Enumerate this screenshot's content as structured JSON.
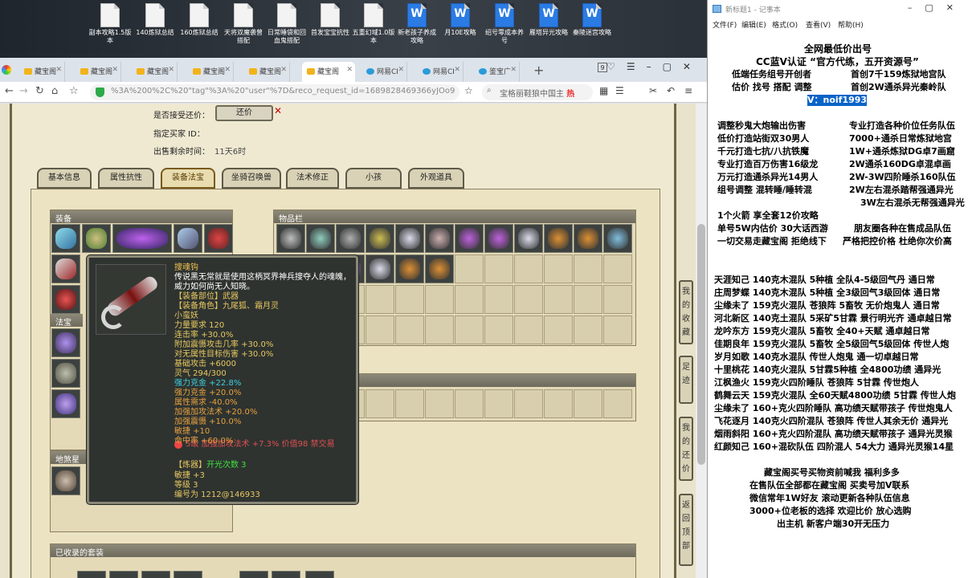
{
  "desktop_icons": [
    {
      "label": "副本攻略1.5版本",
      "type": "doc"
    },
    {
      "label": "140炼狱总结",
      "type": "doc"
    },
    {
      "label": "160炼狱总结",
      "type": "doc"
    },
    {
      "label": "天将双魔袭曾搭配",
      "type": "doc"
    },
    {
      "label": "日常睡袋和回血鬼搭配",
      "type": "doc"
    },
    {
      "label": "首发宝宝抗性",
      "type": "doc"
    },
    {
      "label": "五重幻域1.0版本",
      "type": "doc"
    },
    {
      "label": "新老孩子养成攻略",
      "type": "word"
    },
    {
      "label": "月10E攻略",
      "type": "word"
    },
    {
      "label": "绍号零成本养号",
      "type": "word"
    },
    {
      "label": "雁塔异光攻略",
      "type": "word"
    },
    {
      "label": "秦陵迷宫攻略",
      "type": "word"
    }
  ],
  "browser": {
    "tabs": [
      {
        "label": "藏宝阁",
        "icon": "treasure"
      },
      {
        "label": "藏宝阁",
        "icon": "treasure"
      },
      {
        "label": "藏宝阁",
        "icon": "treasure"
      },
      {
        "label": "藏宝阁",
        "icon": "treasure"
      },
      {
        "label": "藏宝阁",
        "icon": "treasure"
      },
      {
        "label": "藏宝阁",
        "icon": "treasure",
        "active": true
      },
      {
        "label": "网易CI",
        "icon": "globe"
      },
      {
        "label": "网易CI",
        "icon": "globe"
      },
      {
        "label": "鉴宝广",
        "icon": "globe"
      }
    ],
    "tab_count": "9",
    "url": "%3A%200%2C%20\"tag\"%3A%20\"user\"%7D&reco_request_id=1689828469366yJOo9",
    "search_text": "宝格丽鞋狼中国主",
    "search_hot": "热"
  },
  "listing": {
    "accept_offer_label": "是否接受还价：",
    "offer_button": "还价",
    "seller_id_label": "指定买家 ID：",
    "time_label": "出售剩余时间：",
    "time_value": "11天6时"
  },
  "game_tabs": [
    "基本信息",
    "属性抗性",
    "装备法宝",
    "坐骑召唤兽",
    "法术修正",
    "小孩",
    "外观道具"
  ],
  "active_tab": "装备法宝",
  "sections": {
    "equipment": "装备",
    "inventory": "物品栏",
    "fabao": "法宝",
    "fabao2": "地煞星",
    "suits": "已收录的套装"
  },
  "side_buttons": [
    "我的收藏",
    "足迹",
    "我的还价",
    "返回顶部"
  ],
  "tooltip": {
    "name": "搜魂钩",
    "desc1": "传说黑无常就是使用这柄冥界神兵搜夺人的魂魄，",
    "desc2": "威力如何尚无人知晓。",
    "slot": "【装备部位】武器",
    "role": "【装备角色】九尾狐、霜月灵",
    "role2": "小蛮妖",
    "lines": [
      {
        "t": "力量要求 120",
        "c": "#e8c860"
      },
      {
        "t": "连击率 +30.0%",
        "c": "#e8c860"
      },
      {
        "t": "附加震慑攻击几率 +30.0%",
        "c": "#e8c860"
      },
      {
        "t": "对无属性目标伤害 +30.0%",
        "c": "#e8c860"
      },
      {
        "t": "基础攻击 +6000",
        "c": "#e8c860"
      },
      {
        "t": "灵气 294/300",
        "c": "#e8c860"
      },
      {
        "t": "强力克金 +22.8%",
        "c": "#3fd0e0"
      },
      {
        "t": "强力克金 +20.0%",
        "c": "#e8a040"
      },
      {
        "t": "属性需求 -40.0%",
        "c": "#e8a040"
      },
      {
        "t": "加强加攻法术 +20.0%",
        "c": "#e8a040"
      },
      {
        "t": "加强震慑 +10.0%",
        "c": "#e8a040"
      },
      {
        "t": "敏捷 +10",
        "c": "#e8a040"
      },
      {
        "t": "命中率 +60.0%",
        "c": "#e8a040"
      }
    ],
    "gem": "5级 加强加攻法术 +7.3% 价值98 禁交易",
    "refine_label": "【炼器】",
    "refine_val": "开光次数 3",
    "tail": [
      {
        "t": "敏捷 +3",
        "c": "#e8c860"
      },
      {
        "t": "等级 3",
        "c": "#e8c860"
      },
      {
        "t": "编号为 1212@146933",
        "c": "#e8c860"
      }
    ],
    "colors": {
      "name": "#f0c050",
      "desc": "#ffffff",
      "green": "#40e040"
    }
  },
  "notepad": {
    "title": "新标题1 - 记事本",
    "menu": [
      "文件(F)",
      "编辑(E)",
      "格式(O)",
      "查看(V)",
      "帮助(H)"
    ],
    "header": [
      "全网最低价出号",
      "CC蓝V认证 “官方代练，五开资源号”",
      "低端任务组号开创者",
      "首创7千159炼狱地宫队",
      "估价 找号 搭配 调整",
      "首创2W通杀异光秦岭队"
    ],
    "vx": "V：noif1993",
    "services": [
      [
        "调整秒鬼大炮输出伤害",
        "专业打造各种价位任务队伍"
      ],
      [
        "低价打造站街双30男人",
        "7000+通杀日常炼狱地宫"
      ],
      [
        "千元打造七抗/八抗铁魔",
        "1W+通杀炼狱DG卓7画窟"
      ],
      [
        "专业打造百万伤害16级龙",
        "2W通杀160DG卓混卓画"
      ],
      [
        "万元打造通杀异光14男人",
        "2W-3W四阶睡杀160队伍"
      ],
      [
        "组号调整 混转睡/睡转混",
        "2W左右混杀踏帮强通异光"
      ],
      [
        "",
        "3W左右混杀无帮强通异光"
      ]
    ],
    "promo": [
      "1个火箭 享全套12价攻略",
      "单号5W内估价 30大话西游",
      "朋友圈各种在售成品队伍",
      "一切交易走藏宝阁 拒绝线下",
      "严格把控价格 杜绝你次价高"
    ],
    "teams": [
      "天涯知己 140克木混队 5种植 全队4-5级回气丹 通日常",
      "庄周梦蝶 140克木混队 5种植 全3级回气3级回体 通日常",
      "尘缘未了 159克火混队 苍狼阵 5畜牧 无价炮鬼人 通日常",
      "河北新区 140克土混队 5采矿5甘霖 景行明光齐 通卓越日常",
      "龙吟东方 159克火混队 5畜牧 全40+天赋 通卓越日常",
      "佳期良年 159克火混队 5畜牧 全5级回气5级回体 传世人炮",
      "岁月如歌 140克水混队 传世人炮鬼 通一切卓越日常",
      "十里桃花 140克火混队 5甘霖5种植 全4800功绩 通异光",
      "江枫渔火 159克火四阶睡队 苍狼阵 5甘霖 传世炮人",
      "鹤舞云天 159克火混队 全60天赋4800功绩 5甘霖 传世人炮",
      "尘缘未了 160+克火四阶睡队 高功绩天赋带孩子 传世炮鬼人",
      "飞花逐月 140克火四阶混队 苍狼阵 传世人其余无价 通异光",
      "烟雨斜阳 160+克火四阶混队 高功绩天赋带孩子 通异光灵猴",
      "红颜知己 160+混砍队伍 四阶混人 54大力 通异光灵猴14星"
    ],
    "footer": [
      "藏宝阁买号买物资前喊我 福利多多",
      "在售队伍全部都在藏宝阁 买卖号加V联系",
      "微信常年1W好友 滚动更新各种队伍信息",
      "3000+位老板的选择 欢迎比价 放心选购",
      "出主机 新客户端30开无压力"
    ]
  }
}
